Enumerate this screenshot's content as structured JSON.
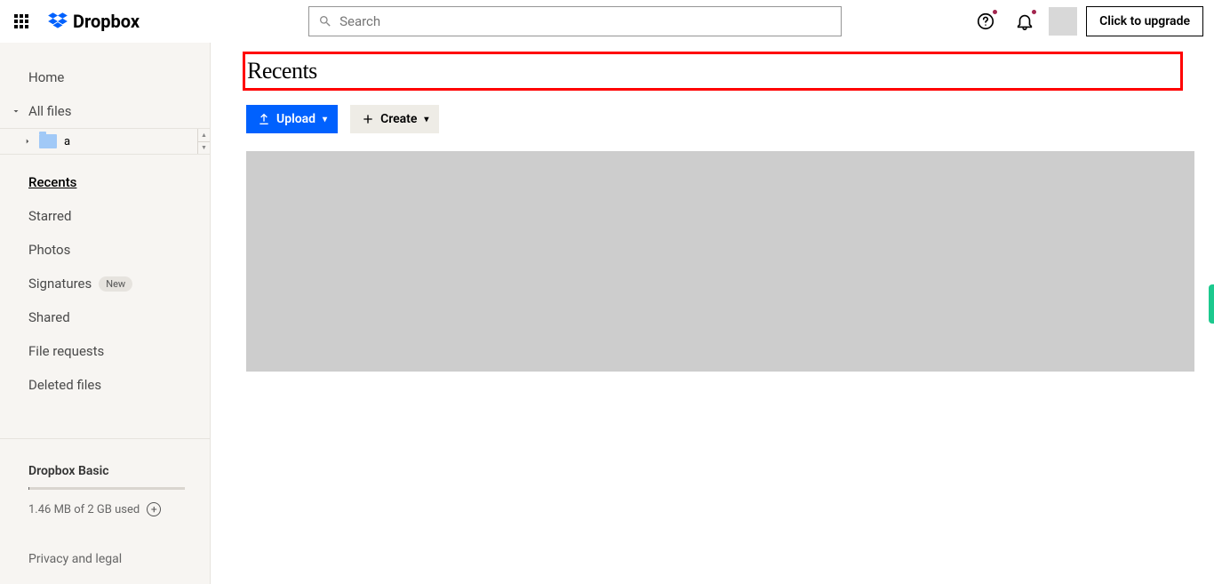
{
  "header": {
    "brand": "Dropbox",
    "search_placeholder": "Search",
    "upgrade_label": "Click to upgrade"
  },
  "sidebar": {
    "home": "Home",
    "all_files": "All files",
    "tree_folder": "a",
    "recents": "Recents",
    "starred": "Starred",
    "photos": "Photos",
    "signatures": "Signatures",
    "signatures_badge": "New",
    "shared": "Shared",
    "file_requests": "File requests",
    "deleted": "Deleted files",
    "plan_name": "Dropbox Basic",
    "usage": "1.46 MB of 2 GB used",
    "legal": "Privacy and legal"
  },
  "main": {
    "title": "Recents",
    "upload_label": "Upload",
    "create_label": "Create"
  }
}
